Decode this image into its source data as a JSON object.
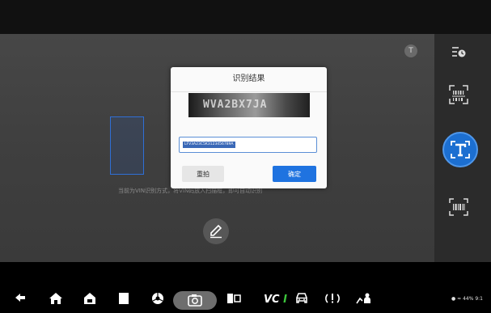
{
  "camera": {
    "hint": "当前为VIN识别方式，将VIN码放入扫描框，即可自动识别",
    "flash_symbol": "T"
  },
  "dialog": {
    "title": "识别结果",
    "image_text": "WVA2BX7JA",
    "input_value": "LFV3A23C5K3123456789A",
    "retake_label": "重拍",
    "confirm_label": "确定"
  },
  "side_panel": {
    "items": [
      "history-icon",
      "vin-barcode-icon",
      "text-recognition-icon",
      "barcode-scan-icon"
    ],
    "active": "text-recognition-icon"
  },
  "navbar": {
    "vci_label": "VCI",
    "vci_accent": "#3cc43c",
    "status": "44% 9:1"
  },
  "colors": {
    "accent": "#1f73e0",
    "panel": "#2b2b2b"
  }
}
